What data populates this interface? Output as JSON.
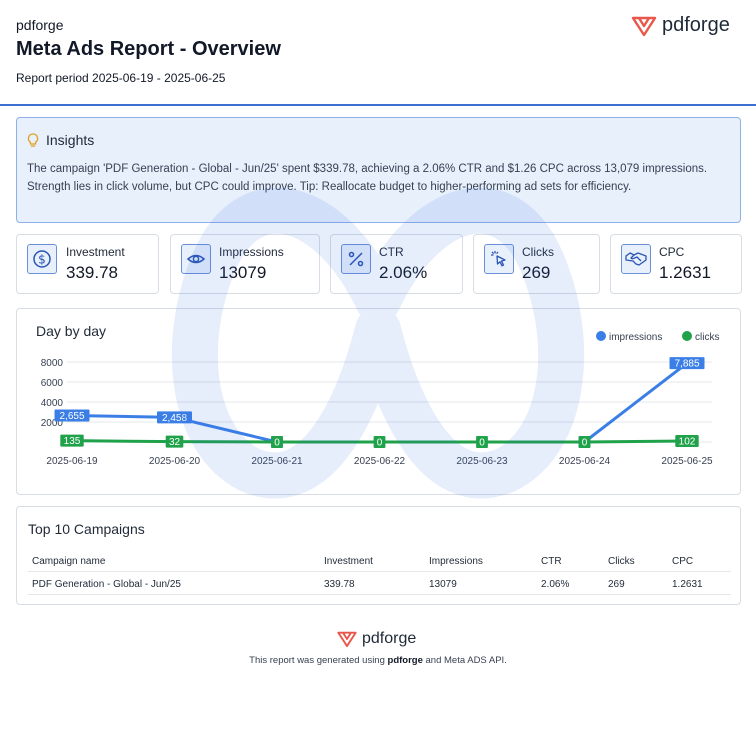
{
  "header": {
    "brand": "pdforge",
    "title": "Meta Ads Report - Overview",
    "period": "Report period 2025-06-19 - 2025-06-25",
    "logo_text": "pdforge"
  },
  "insights": {
    "title": "Insights",
    "text": "The campaign 'PDF Generation - Global - Jun/25' spent $339.78, achieving a 2.06% CTR and $1.26 CPC across 13,079 impressions. Strength lies in click volume, but CPC could improve. Tip: Reallocate budget to higher-performing ad sets for efficiency."
  },
  "kpis": [
    {
      "label": "Investment",
      "value": "339.78",
      "icon": "dollar-icon"
    },
    {
      "label": "Impressions",
      "value": "13079",
      "icon": "eye-icon"
    },
    {
      "label": "CTR",
      "value": "2.06%",
      "icon": "percent-icon"
    },
    {
      "label": "Clicks",
      "value": "269",
      "icon": "cursor-click-icon"
    },
    {
      "label": "CPC",
      "value": "1.2631",
      "icon": "handshake-icon"
    }
  ],
  "chart_data": {
    "type": "line",
    "title": "Day by day",
    "categories": [
      "2025-06-19",
      "2025-06-20",
      "2025-06-21",
      "2025-06-22",
      "2025-06-23",
      "2025-06-24",
      "2025-06-25"
    ],
    "series": [
      {
        "name": "impressions",
        "values": [
          2655,
          2458,
          0,
          null,
          null,
          0,
          7885
        ],
        "labels": [
          "2,655",
          "2,458",
          "0",
          "",
          "",
          "0",
          "7,885"
        ],
        "color": "#3b7fe6"
      },
      {
        "name": "clicks",
        "values": [
          135,
          32,
          0,
          0,
          0,
          0,
          102
        ],
        "labels": [
          "135",
          "32",
          "0",
          "0",
          "0",
          "0",
          "102"
        ],
        "color": "#1fa24a"
      }
    ],
    "y_ticks": [
      "8000",
      "6000",
      "4000",
      "2000"
    ],
    "ylim": [
      0,
      8000
    ],
    "legend": "top-right",
    "grid": true
  },
  "campaigns": {
    "title": "Top 10 Campaigns",
    "columns": [
      "Campaign name",
      "Investment",
      "Impressions",
      "CTR",
      "Clicks",
      "CPC"
    ],
    "rows": [
      [
        "PDF Generation - Global - Jun/25",
        "339.78",
        "13079",
        "2.06%",
        "269",
        "1.2631"
      ]
    ]
  },
  "footer": {
    "logo_text": "pdforge",
    "note_prefix": "This report was generated using ",
    "note_brand": "pdforge",
    "note_suffix": " and Meta ADS API."
  },
  "colors": {
    "accent": "#3b6fd0",
    "impressions": "#3b7fe6",
    "clicks": "#1fa24a",
    "logo": "#e8574a"
  }
}
